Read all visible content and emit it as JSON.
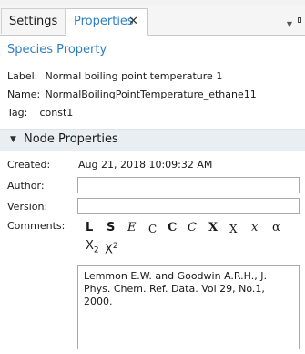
{
  "tabs": [
    {
      "label": "Settings",
      "active": false
    },
    {
      "label": "Properties",
      "active": true,
      "close_glyph": "✕"
    }
  ],
  "tabbar_icons": {
    "menu": "chevron-down-icon",
    "pin": "pin-icon"
  },
  "section_title": "Species Property",
  "info": {
    "label_key": "Label:",
    "label_value": "Normal boiling point temperature 1",
    "name_key": "Name:",
    "name_value": "NormalBoilingPointTemperature_ethane11",
    "tag_key": "Tag:",
    "tag_value": "const1"
  },
  "node_properties": {
    "title": "Node Properties",
    "caret": "▼",
    "created_label": "Created:",
    "created_value": "Aug 21, 2018 10:09:32 AM",
    "author_label": "Author:",
    "author_value": "",
    "version_label": "Version:",
    "version_value": "",
    "comments_label": "Comments:",
    "comment_text": "Lemmon E.W. and Goodwin A.R.H., J. Phys. Chem. Ref. Data. Vol 29, No.1, 2000."
  },
  "symbols": [
    {
      "name": "lambda-bold-icon",
      "glyph": "L"
    },
    {
      "name": "sigma-bold-icon",
      "glyph": "S"
    },
    {
      "name": "epsilon-italic-icon",
      "glyph": "E"
    },
    {
      "name": "c-small-icon",
      "glyph": "C"
    },
    {
      "name": "c-bold-icon",
      "glyph": "C"
    },
    {
      "name": "c-italic-icon",
      "glyph": "C"
    },
    {
      "name": "x-bold-icon",
      "glyph": "X"
    },
    {
      "name": "x-small-icon",
      "glyph": "X"
    },
    {
      "name": "x-italic-icon",
      "glyph": "x"
    },
    {
      "name": "alpha-icon",
      "glyph": "α"
    }
  ],
  "subscript": {
    "base": "X",
    "sub": "2"
  },
  "superscript": {
    "base": "X",
    "sup": "2"
  },
  "colors": {
    "accent": "#2f7fc1",
    "header_bg": "#e9eef3"
  }
}
